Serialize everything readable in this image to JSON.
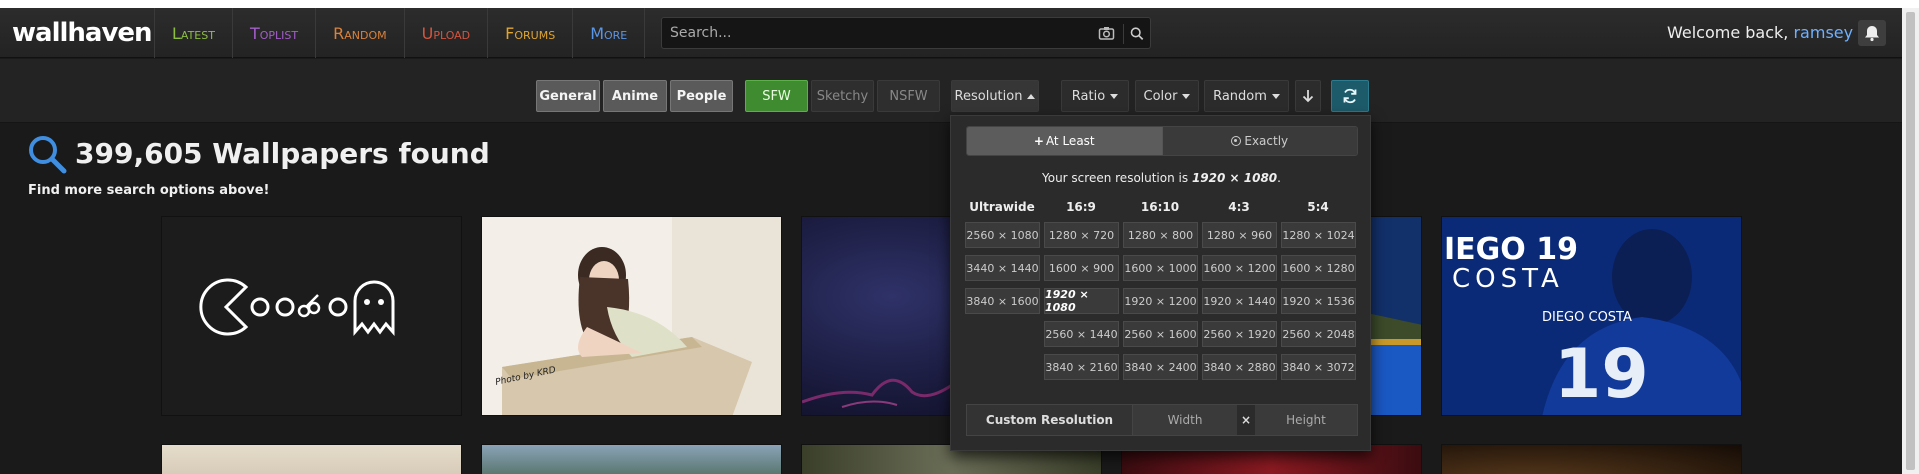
{
  "header": {
    "logo": "wallhaven",
    "nav": [
      {
        "label": "Latest",
        "color": "#8cbf3f"
      },
      {
        "label": "Toplist",
        "color": "#a35ec9"
      },
      {
        "label": "Random",
        "color": "#d9823b"
      },
      {
        "label": "Upload",
        "color": "#d4543f"
      },
      {
        "label": "Forums",
        "color": "#e0a530"
      },
      {
        "label": "More",
        "color": "#5a96e8"
      }
    ],
    "search_placeholder": "Search...",
    "welcome_text": "Welcome back, ",
    "username": "ramsey"
  },
  "filters": {
    "categories": [
      "General",
      "Anime",
      "People"
    ],
    "purity": [
      "SFW",
      "Sketchy",
      "NSFW"
    ],
    "dropdowns": [
      "Resolution",
      "Ratio",
      "Color",
      "Random"
    ]
  },
  "results": {
    "title": "399,605 Wallpapers found",
    "subtitle": "Find more search options above!"
  },
  "resolution_panel": {
    "mode_atleast": "At Least",
    "mode_exactly": "Exactly",
    "screen_res_prefix": "Your screen resolution is ",
    "screen_res": "1920 × 1080",
    "screen_res_suffix": ".",
    "columns": [
      {
        "name": "Ultrawide",
        "values": [
          "2560 × 1080",
          "3440 × 1440",
          "3840 × 1600"
        ]
      },
      {
        "name": "16:9",
        "values": [
          "1280 × 720",
          "1600 × 900",
          "1920 × 1080",
          "2560 × 1440",
          "3840 × 2160"
        ]
      },
      {
        "name": "16:10",
        "values": [
          "1280 × 800",
          "1600 × 1000",
          "1920 × 1200",
          "2560 × 1600",
          "3840 × 2400"
        ]
      },
      {
        "name": "4:3",
        "values": [
          "1280 × 960",
          "1600 × 1200",
          "1920 × 1440",
          "2560 × 1920",
          "3840 × 2880"
        ]
      },
      {
        "name": "5:4",
        "values": [
          "1280 × 1024",
          "1600 × 1280",
          "1920 × 1536",
          "2560 × 2048",
          "3840 × 3072"
        ]
      }
    ],
    "custom_label": "Custom Resolution",
    "width_placeholder": "Width",
    "times": "×",
    "height_placeholder": "Height"
  },
  "thumbnails": {
    "photo_watermark": "Photo by KRD",
    "diego_name": "IEGO 19",
    "diego_sub": "COSTA",
    "jersey_name": "DIEGO COSTA",
    "jersey_number": "19"
  },
  "colors": {
    "accent_blue": "#5aa0ff",
    "sfw_green": "#3f8b2f"
  }
}
